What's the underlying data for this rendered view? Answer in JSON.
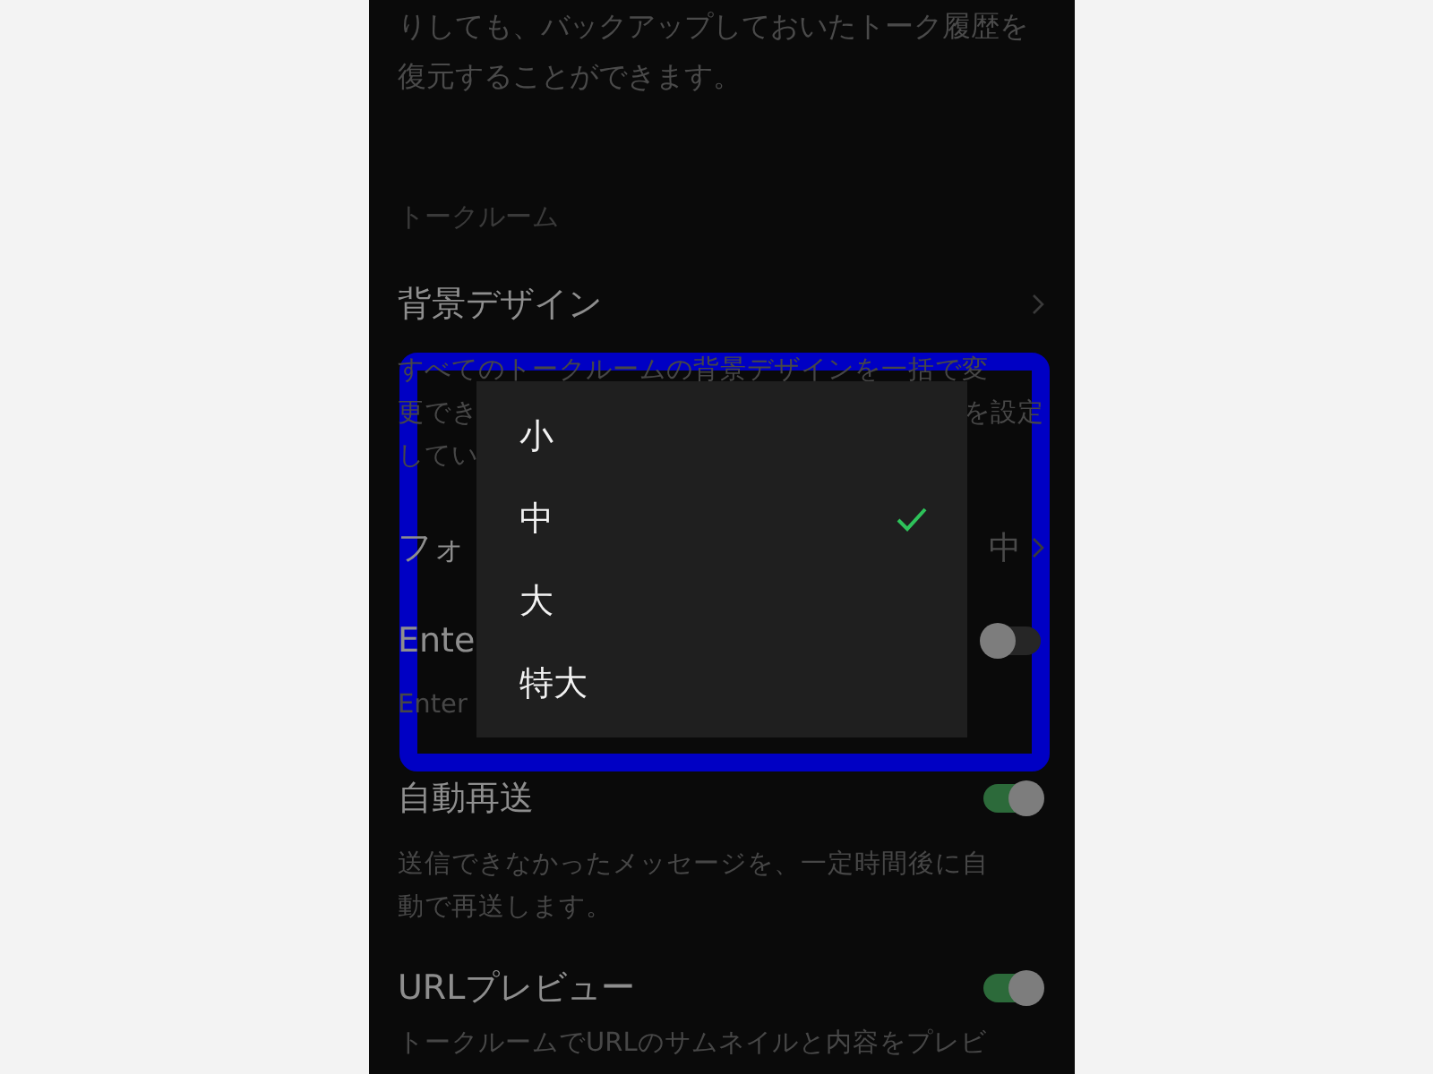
{
  "background_screen": {
    "backup_note": [
      "りしても、バックアップしておいたトーク履歴を",
      "復元することができます。"
    ],
    "section_header": "トークルーム",
    "settings": [
      {
        "kind": "link",
        "title": "背景デザイン",
        "description_lines": [
          {
            "left": "すべてのトークルームの背景デザインを一括で変"
          },
          {
            "left": "更でき",
            "right": "を設定"
          },
          {
            "left": "してい"
          }
        ]
      },
      {
        "kind": "link",
        "title": "フォ",
        "value": "中"
      },
      {
        "kind": "toggle",
        "title": "Ente",
        "on": false,
        "description_lines": [
          {
            "left": "Enter"
          }
        ]
      },
      {
        "kind": "toggle",
        "title": "自動再送",
        "on": true,
        "description_lines": [
          {
            "left": "送信できなかったメッセージを、一定時間後に自"
          },
          {
            "left": "動で再送します。"
          }
        ]
      },
      {
        "kind": "toggle",
        "title": "URLプレビュー",
        "on": true,
        "description_lines": [
          {
            "left": "トークルームでURLのサムネイルと内容をプレビ"
          }
        ]
      }
    ]
  },
  "font_size_menu": {
    "options": [
      {
        "label": "小",
        "selected": false
      },
      {
        "label": "中",
        "selected": true
      },
      {
        "label": "大",
        "selected": false
      },
      {
        "label": "特大",
        "selected": false
      }
    ]
  }
}
